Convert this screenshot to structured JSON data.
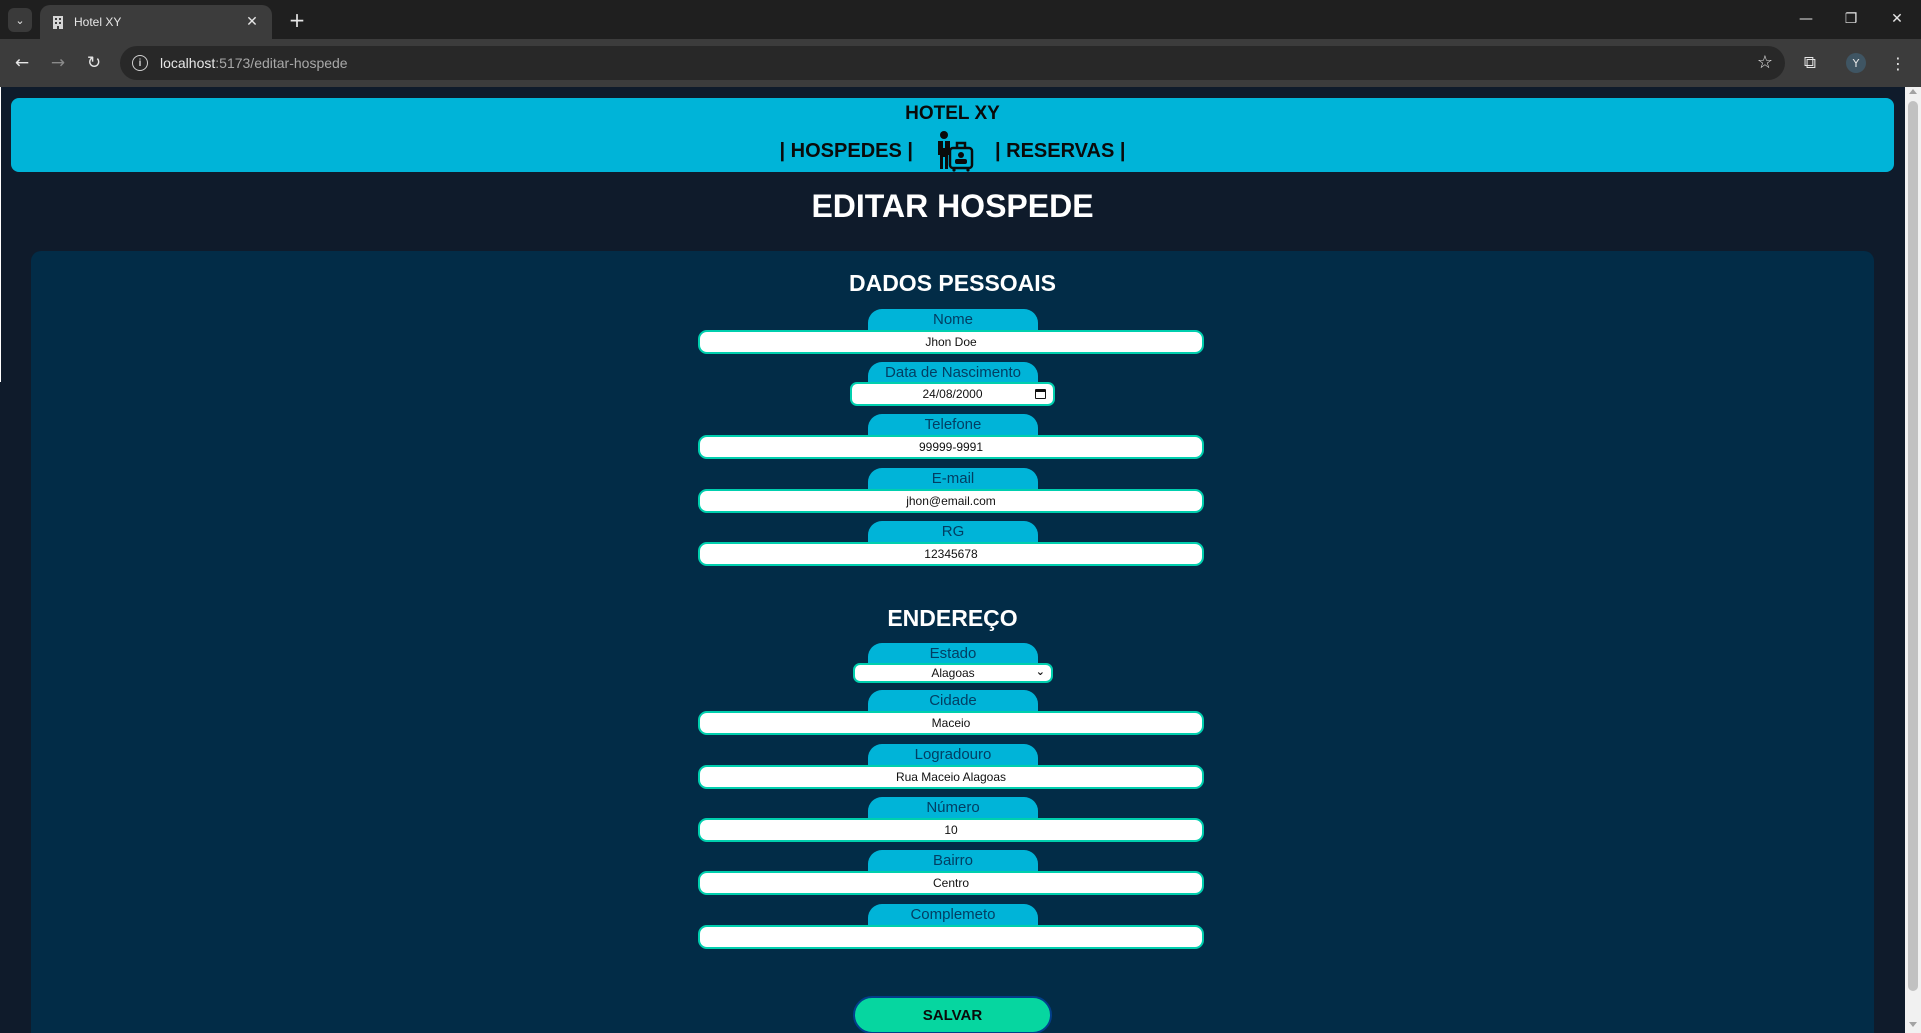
{
  "browser": {
    "tab_title": "Hotel XY",
    "url_host": "localhost",
    "url_path": ":5173/editar-hospede",
    "profile_initial": "Y"
  },
  "header": {
    "brand": "HOTEL XY",
    "nav_hospedes": "| HOSPEDES |",
    "nav_reservas": "| RESERVAS |",
    "background_color": "#00b4d8"
  },
  "page": {
    "title": "EDITAR HOSPEDE"
  },
  "dados_pessoais": {
    "title": "DADOS PESSOAIS",
    "nome": {
      "label": "Nome",
      "value": "Jhon Doe"
    },
    "nascimento": {
      "label": "Data de Nascimento",
      "value": "24/08/2000"
    },
    "telefone": {
      "label": "Telefone",
      "value": "99999-9991"
    },
    "email": {
      "label": "E-mail",
      "value": "jhon@email.com"
    },
    "rg": {
      "label": "RG",
      "value": "12345678"
    }
  },
  "endereco": {
    "title": "ENDEREÇO",
    "estado": {
      "label": "Estado",
      "value": "Alagoas"
    },
    "cidade": {
      "label": "Cidade",
      "value": "Maceio"
    },
    "logradouro": {
      "label": "Logradouro",
      "value": "Rua Maceio Alagoas"
    },
    "numero": {
      "label": "Número",
      "value": "10"
    },
    "bairro": {
      "label": "Bairro",
      "value": "Centro"
    },
    "complemento": {
      "label": "Complemeto",
      "value": ""
    }
  },
  "actions": {
    "save_label": "SALVAR",
    "save_color": "#06d6a0"
  }
}
